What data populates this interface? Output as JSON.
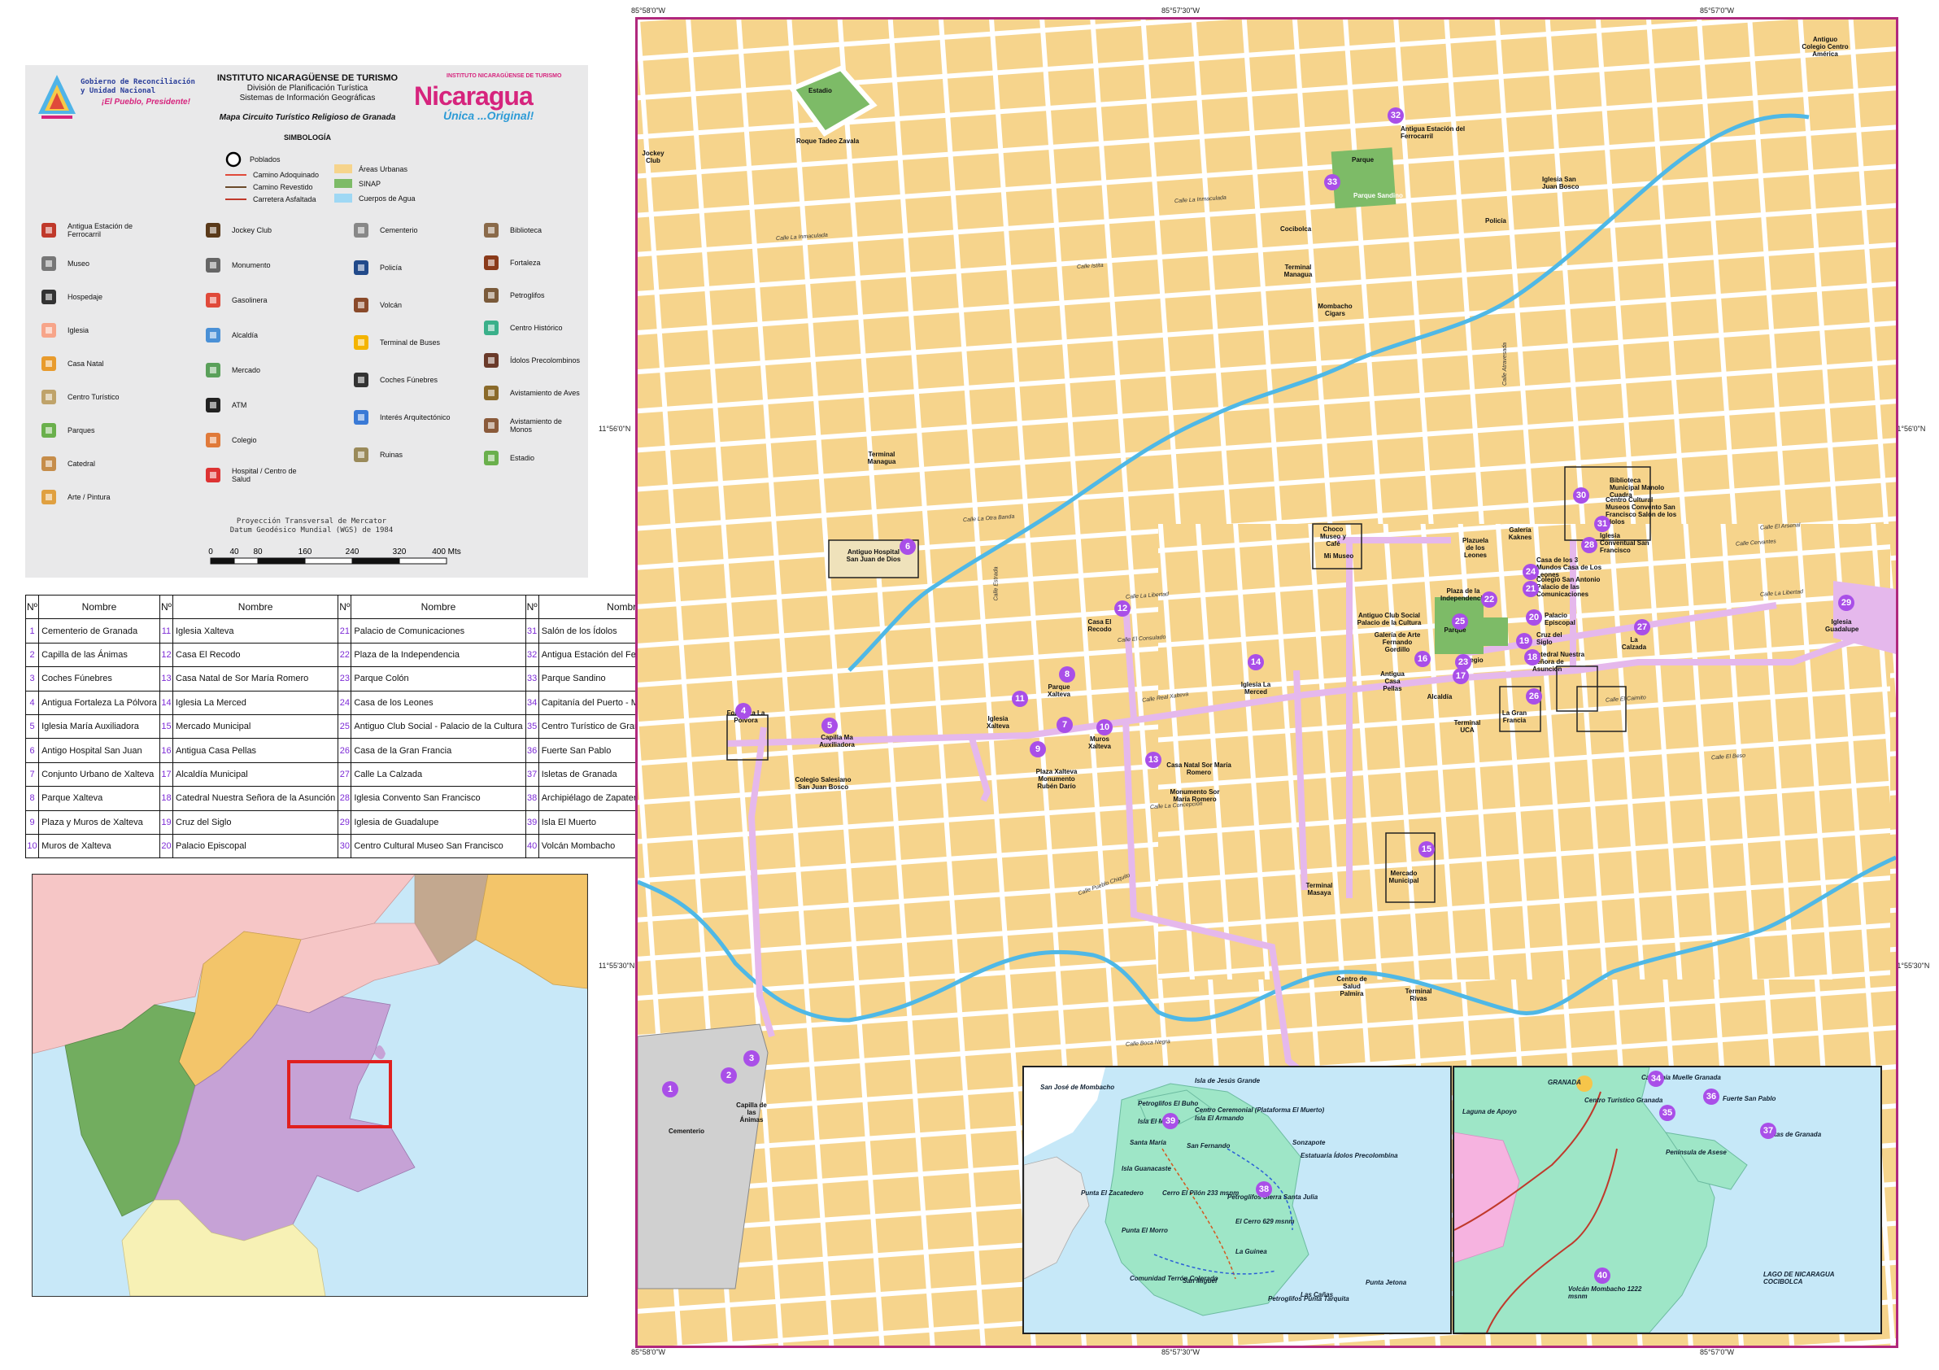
{
  "header": {
    "institute": "INSTITUTO NICARAGÜENSE DE TURISMO",
    "division": "División de Planificación Turística",
    "systems": "Sistemas de Información Geográficas",
    "map_title": "Mapa Circuito Turístico Religioso de Granada",
    "simbologia": "SIMBOLOGÍA"
  },
  "logos": {
    "gov_line1": "Gobierno de Reconciliación",
    "gov_line2": "y Unidad Nacional",
    "gov_slogan": "¡El Pueblo, Presidente!",
    "nica_small": "INSTITUTO NICARAGÜENSE DE TURISMO",
    "nica_big": "Nicaragua",
    "nica_tag": "Única ...Original!"
  },
  "symbology_lines": [
    {
      "label": "Poblados",
      "kind": "circle"
    },
    {
      "label": "Camino Adoquinado",
      "kind": "line",
      "color": "#e04a3a"
    },
    {
      "label": "Camino Revestido",
      "kind": "line",
      "color": "#6a4a2a"
    },
    {
      "label": "Carretera Asfaltada",
      "kind": "line",
      "color": "#c0392b"
    }
  ],
  "symbology_areas": [
    {
      "label": "Áreas Urbanas",
      "color": "#f6d48c"
    },
    {
      "label": "SINAP",
      "color": "#7dbb67"
    },
    {
      "label": "Cuerpos de Agua",
      "color": "#9fd8f4"
    }
  ],
  "legend_icons": [
    {
      "label": "Antigua Estación de Ferrocarril",
      "icon": "train-station-icon"
    },
    {
      "label": "Museo",
      "icon": "museum-icon"
    },
    {
      "label": "Hospedaje",
      "icon": "bed-icon"
    },
    {
      "label": "Iglesia",
      "icon": "church-icon"
    },
    {
      "label": "Casa Natal",
      "icon": "house-icon"
    },
    {
      "label": "Centro Turístico",
      "icon": "beach-icon"
    },
    {
      "label": "Parques",
      "icon": "park-icon"
    },
    {
      "label": "Catedral",
      "icon": "cathedral-icon"
    },
    {
      "label": "Arte / Pintura",
      "icon": "palette-icon"
    },
    {
      "label": "Jockey Club",
      "icon": "horse-icon"
    },
    {
      "label": "Monumento",
      "icon": "monument-icon"
    },
    {
      "label": "Gasolinera",
      "icon": "fuel-icon"
    },
    {
      "label": "Alcaldía",
      "icon": "city-hall-icon"
    },
    {
      "label": "Mercado",
      "icon": "market-cart-icon"
    },
    {
      "label": "ATM",
      "icon": "atm-icon"
    },
    {
      "label": "Colegio",
      "icon": "school-icon"
    },
    {
      "label": "Hospital / Centro de Salud",
      "icon": "hospital-icon"
    },
    {
      "label": "Cementerio",
      "icon": "cemetery-icon"
    },
    {
      "label": "Policía",
      "icon": "police-icon"
    },
    {
      "label": "Volcán",
      "icon": "volcano-icon"
    },
    {
      "label": "Terminal de Buses",
      "icon": "bus-icon"
    },
    {
      "label": "Coches Fúnebres",
      "icon": "carriage-icon"
    },
    {
      "label": "Interés Arquitectónico",
      "icon": "building-icon"
    },
    {
      "label": "Ruinas",
      "icon": "ruins-icon"
    },
    {
      "label": "Biblioteca",
      "icon": "library-icon"
    },
    {
      "label": "Fortaleza",
      "icon": "fortress-icon"
    },
    {
      "label": "Petroglifos",
      "icon": "petroglyph-icon"
    },
    {
      "label": "Centro Histórico",
      "icon": "flag-icon"
    },
    {
      "label": "Ídolos Precolombinos",
      "icon": "idol-icon"
    },
    {
      "label": "Avistamiento de Aves",
      "icon": "bird-icon"
    },
    {
      "label": "Avistamiento de Monos",
      "icon": "monkey-icon"
    },
    {
      "label": "Estadio",
      "icon": "stadium-icon"
    }
  ],
  "projection": {
    "line1": "Proyección Transversal de Mercator",
    "line2": "Datum Geodésico Mundial (WGS) de 1984"
  },
  "scale": {
    "ticks": [
      "0",
      "40",
      "80",
      "160",
      "240",
      "320",
      "400 Mts"
    ]
  },
  "table": {
    "col_n": "Nº",
    "col_name": "Nombre",
    "rows": [
      [
        "1",
        "Cementerio de Granada",
        "11",
        "Iglesia Xalteva",
        "21",
        "Palacio de Comunicaciones",
        "31",
        "Salón de los Ídolos"
      ],
      [
        "2",
        "Capilla de las Ánimas",
        "12",
        "Casa El Recodo",
        "22",
        "Plaza de la Independencia",
        "32",
        "Antigua Estación del Ferrocarril"
      ],
      [
        "3",
        "Coches Fúnebres",
        "13",
        "Casa Natal de Sor María Romero",
        "23",
        "Parque Colón",
        "33",
        "Parque Sandino"
      ],
      [
        "4",
        "Antigua Fortaleza La Pólvora",
        "14",
        "Iglesia La Merced",
        "24",
        "Casa de los Leones",
        "34",
        "Capitanía del Puerto - Muelle de Granada"
      ],
      [
        "5",
        "Iglesia María Auxiliadora",
        "15",
        "Mercado Municipal",
        "25",
        "Antiguo Club Social - Palacio de la Cultura",
        "35",
        "Centro Turístico de Granada"
      ],
      [
        "6",
        "Antigo Hospital San Juan",
        "16",
        "Antigua Casa Pellas",
        "26",
        "Casa de la Gran Francia",
        "36",
        "Fuerte San Pablo"
      ],
      [
        "7",
        "Conjunto Urbano de Xalteva",
        "17",
        "Alcaldía Municipal",
        "27",
        "Calle La Calzada",
        "37",
        "Isletas de Granada"
      ],
      [
        "8",
        "Parque Xalteva",
        "18",
        "Catedral Nuestra Señora de la Asunción",
        "28",
        "Iglesia Convento San Francisco",
        "38",
        "Archipiélago de Zapatera"
      ],
      [
        "9",
        "Plaza y Muros de Xalteva",
        "19",
        "Cruz del Siglo",
        "29",
        "Iglesia de Guadalupe",
        "39",
        "Isla El Muerto"
      ],
      [
        "10",
        "Muros de Xalteva",
        "20",
        "Palacio Episcopal",
        "30",
        "Centro Cultural Museo San Francisco",
        "40",
        "Volcán Mombacho"
      ]
    ]
  },
  "coords": {
    "top": [
      "85°58'0\"W",
      "85°57'30\"W",
      "85°57'0\"W"
    ],
    "bottom": [
      "85°58'0\"W",
      "85°57'30\"W",
      "85°57'0\"W"
    ],
    "left": [
      "11°56'0\"N",
      "11°55'30\"N"
    ],
    "right": [
      "11°56'0\"N",
      "11°55'30\"N"
    ]
  },
  "map_labels": {
    "estadio": "Estadio",
    "roque": "Roque Tadeo Zavala",
    "jockey": "Jockey Club",
    "estacion": "Antigua Estación del Ferrocarril",
    "parque_sandino": "Parque Sandino",
    "parque_label": "Parque",
    "iglesia_sanjuan": "Iglesia San Juan Bosco",
    "policia": "Policía",
    "colegio_ca": "Antiguo Colegio Centro América",
    "cocibolca": "Cocibolca",
    "terminal_managua": "Terminal Managua",
    "mombacho_cigars": "Mombacho Cigars",
    "terminal_managua2": "Terminal Managua",
    "hospital": "Antiguo Hospital San Juan de Dios",
    "casa_recodo": "Casa El Recodo",
    "fortaleza": "Fortaleza La Pólvora",
    "capilla": "Capilla Ma Auxiliadora",
    "colegio_sal": "Colegio Salesiano San Juan Bosco",
    "iglesia_xalteva": "Iglesia Xalteva",
    "parque_xalteva": "Parque Xalteva",
    "muros": "Muros Xalteva",
    "plaza_xalteva": "Plaza Xalteva Monumento Rubén Darío",
    "casa_natal": "Casa Natal Sor María Romero",
    "monumento": "Monumento Sor María Romero",
    "merced": "Iglesia La Merced",
    "mercado": "Mercado Municipal",
    "terminal_masaya": "Terminal Masaya",
    "centro_salud": "Centro de Salud Palmira",
    "terminal_rivas": "Terminal Rivas",
    "cementerio": "Cementerio",
    "capilla_animas": "Capilla de las Ánimas",
    "choco": "Choco Museo y Café",
    "mi_museo": "Mi Museo",
    "club_social": "Antiguo Club Social Palacio de la Cultura",
    "galeria_arte": "Galería de Arte Fernando Gordillo",
    "casa_pellas": "Antigua Casa Pellas",
    "alcaldia": "Alcaldía",
    "terminal_uca": "Terminal UCA",
    "gran_francia": "La Gran Francia",
    "plaza_indep": "Plaza de la Independencia",
    "galeria_kaknes": "Galería Kaknes",
    "plazuela": "Plazuela de los Leones",
    "tres_mundos": "Casa de los 3 Mundos Casa de Los Leones",
    "colegio_sa": "Colegio San Antonio Palacio de las Comunicaciones",
    "palacio_episcopal": "Palacio Episcopal",
    "cruz_siglo": "Cruz del Siglo",
    "catedral": "Catedral Nuestra Señora de Asunción",
    "biblioteca": "Biblioteca Municipal Manolo Cuadra",
    "centro_cultural": "Centro Cultural Museos Convento San Francisco Salón de los Ídolos",
    "iglesia_conv": "Iglesia Conventual San Francisco",
    "iglesia_guadalupe": "Iglesia Guadalupe",
    "la_calzada": "La Calzada",
    "colegio_label": "Colegio",
    "parque_colon": "Parque"
  },
  "street_labels": [
    "Calle La Inmaculada",
    "Calle La Inmaculada",
    "Calle Istita",
    "Calle La Otra Banda",
    "Calle La Libertad",
    "Calle El Consulado",
    "Calle Real Xalteva",
    "Calle La Concepción",
    "Calle Pueblo Chiquito",
    "Calle Boca Negra",
    "Calle El Arsenal",
    "Calle Cervantes",
    "Calle El Caimito",
    "Calle La Libertad",
    "Calle El Beso",
    "Calle Atravesada",
    "Calle Estrada"
  ],
  "markers": [
    {
      "n": "1"
    },
    {
      "n": "2"
    },
    {
      "n": "3"
    },
    {
      "n": "4"
    },
    {
      "n": "5"
    },
    {
      "n": "6"
    },
    {
      "n": "7"
    },
    {
      "n": "8"
    },
    {
      "n": "9"
    },
    {
      "n": "10"
    },
    {
      "n": "11"
    },
    {
      "n": "12"
    },
    {
      "n": "13"
    },
    {
      "n": "14"
    },
    {
      "n": "15"
    },
    {
      "n": "16"
    },
    {
      "n": "17"
    },
    {
      "n": "18"
    },
    {
      "n": "19"
    },
    {
      "n": "20"
    },
    {
      "n": "21"
    },
    {
      "n": "22"
    },
    {
      "n": "23"
    },
    {
      "n": "24"
    },
    {
      "n": "25"
    },
    {
      "n": "26"
    },
    {
      "n": "27"
    },
    {
      "n": "28"
    },
    {
      "n": "29"
    },
    {
      "n": "30"
    },
    {
      "n": "31"
    },
    {
      "n": "32"
    },
    {
      "n": "33"
    }
  ],
  "inset1": {
    "labels": [
      "Isla de Jesús Grande",
      "San José de Mombacho",
      "Petroglifos El Buho",
      "Centro Ceremonial (Plataforma El Muerto)",
      "Isla El Muerto",
      "Isla El Armando",
      "Santa María",
      "San Fernando",
      "Sonzapote",
      "Estatuaria Ídolos Precolombina",
      "Isla Guanacaste",
      "Cerro El Pilón 233 msnm",
      "Punta El Zacatedero",
      "Petroglifos Sierra Santa Julia",
      "El Cerro 629 msnm",
      "Punta El Morro",
      "La Guinea",
      "Comunidad Terrón Colorado",
      "San Miguel",
      "Las Cañas",
      "Punta Jetona",
      "Petroglifos Punta Tarquita"
    ],
    "markers": [
      "39",
      "38"
    ]
  },
  "inset2": {
    "labels": [
      "GRANADA",
      "Centro Turístico Granada",
      "Capitanía Muelle Granada",
      "Fuerte San Pablo",
      "Península de Asese",
      "Isletas de Granada",
      "Laguna de Apoyo",
      "Volcán Mombacho 1222 msnm",
      "LAGO DE NICARAGUA COCIBOLCA"
    ],
    "markers": [
      "34",
      "35",
      "36",
      "37",
      "40"
    ]
  },
  "colors": {
    "urban": "#f6d48c",
    "route": "#e5b8ec",
    "river": "#4fb8e6",
    "sinap": "#7dbb67",
    "frame": "#b0287d",
    "marker": "#a94fe8"
  }
}
